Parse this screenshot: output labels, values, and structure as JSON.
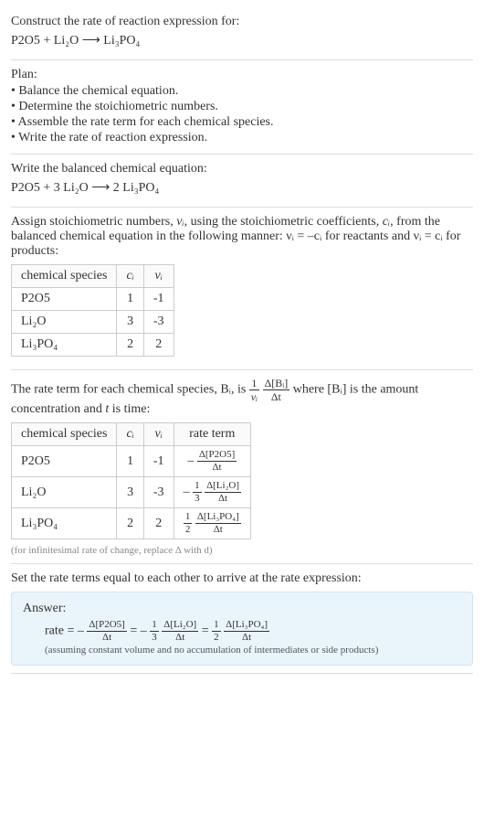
{
  "intro": {
    "title": "Construct the rate of reaction expression for:",
    "equation": "P2O5 + Li₂O ⟶ Li₃PO₄"
  },
  "plan": {
    "title": "Plan:",
    "items": [
      "• Balance the chemical equation.",
      "• Determine the stoichiometric numbers.",
      "• Assemble the rate term for each chemical species.",
      "• Write the rate of reaction expression."
    ]
  },
  "balanced": {
    "title": "Write the balanced chemical equation:",
    "equation": "P2O5 + 3 Li₂O ⟶ 2 Li₃PO₄"
  },
  "stoich": {
    "desc_pre": "Assign stoichiometric numbers, ",
    "desc_nu": "νᵢ",
    "desc_mid1": ", using the stoichiometric coefficients, ",
    "desc_ci": "cᵢ",
    "desc_mid2": ", from the balanced chemical equation in the following manner: ",
    "desc_react": "νᵢ = –cᵢ",
    "desc_mid3": " for reactants and ",
    "desc_prod": "νᵢ = cᵢ",
    "desc_end": " for products:",
    "headers": {
      "species": "chemical species",
      "ci": "cᵢ",
      "nui": "νᵢ"
    },
    "rows": [
      {
        "species": "P2O5",
        "ci": "1",
        "nui": "-1"
      },
      {
        "species": "Li₂O",
        "ci": "3",
        "nui": "-3"
      },
      {
        "species": "Li₃PO₄",
        "ci": "2",
        "nui": "2"
      }
    ]
  },
  "rateterm": {
    "desc_p1": "The rate term for each chemical species, Bᵢ, is ",
    "frac1_num": "1",
    "frac1_den": "νᵢ",
    "frac2_num": "Δ[Bᵢ]",
    "frac2_den": "Δt",
    "desc_p2": " where [Bᵢ] is the amount concentration and ",
    "desc_t": "t",
    "desc_p3": " is time:",
    "headers": {
      "species": "chemical species",
      "ci": "cᵢ",
      "nui": "νᵢ",
      "rate": "rate term"
    },
    "rows": [
      {
        "species": "P2O5",
        "ci": "1",
        "nui": "-1",
        "pre": "–",
        "coef_num": "",
        "coef_den": "",
        "num": "Δ[P2O5]",
        "den": "Δt"
      },
      {
        "species": "Li₂O",
        "ci": "3",
        "nui": "-3",
        "pre": "–",
        "coef_num": "1",
        "coef_den": "3",
        "num": "Δ[Li₂O]",
        "den": "Δt"
      },
      {
        "species": "Li₃PO₄",
        "ci": "2",
        "nui": "2",
        "pre": "",
        "coef_num": "1",
        "coef_den": "2",
        "num": "Δ[Li₃PO₄]",
        "den": "Δt"
      }
    ],
    "note": "(for infinitesimal rate of change, replace Δ with d)"
  },
  "final": {
    "set_text": "Set the rate terms equal to each other to arrive at the rate expression:",
    "answer_label": "Answer:",
    "rate_eq": "rate = ",
    "t1_pre": "–",
    "t1_num": "Δ[P2O5]",
    "t1_den": "Δt",
    "eq1": " = ",
    "t2_pre": "–",
    "t2_cnum": "1",
    "t2_cden": "3",
    "t2_num": "Δ[Li₂O]",
    "t2_den": "Δt",
    "eq2": " = ",
    "t3_pre": "",
    "t3_cnum": "1",
    "t3_cden": "2",
    "t3_num": "Δ[Li₃PO₄]",
    "t3_den": "Δt",
    "assumption": "(assuming constant volume and no accumulation of intermediates or side products)"
  },
  "chart_data": {
    "type": "table",
    "tables": [
      {
        "title": "stoichiometric numbers",
        "columns": [
          "chemical species",
          "c_i",
          "nu_i"
        ],
        "rows": [
          [
            "P2O5",
            1,
            -1
          ],
          [
            "Li2O",
            3,
            -3
          ],
          [
            "Li3PO4",
            2,
            2
          ]
        ]
      },
      {
        "title": "rate terms",
        "columns": [
          "chemical species",
          "c_i",
          "nu_i",
          "rate term"
        ],
        "rows": [
          [
            "P2O5",
            1,
            -1,
            "-(Δ[P2O5]/Δt)"
          ],
          [
            "Li2O",
            3,
            -3,
            "-(1/3)(Δ[Li2O]/Δt)"
          ],
          [
            "Li3PO4",
            2,
            2,
            "(1/2)(Δ[Li3PO4]/Δt)"
          ]
        ]
      }
    ]
  }
}
